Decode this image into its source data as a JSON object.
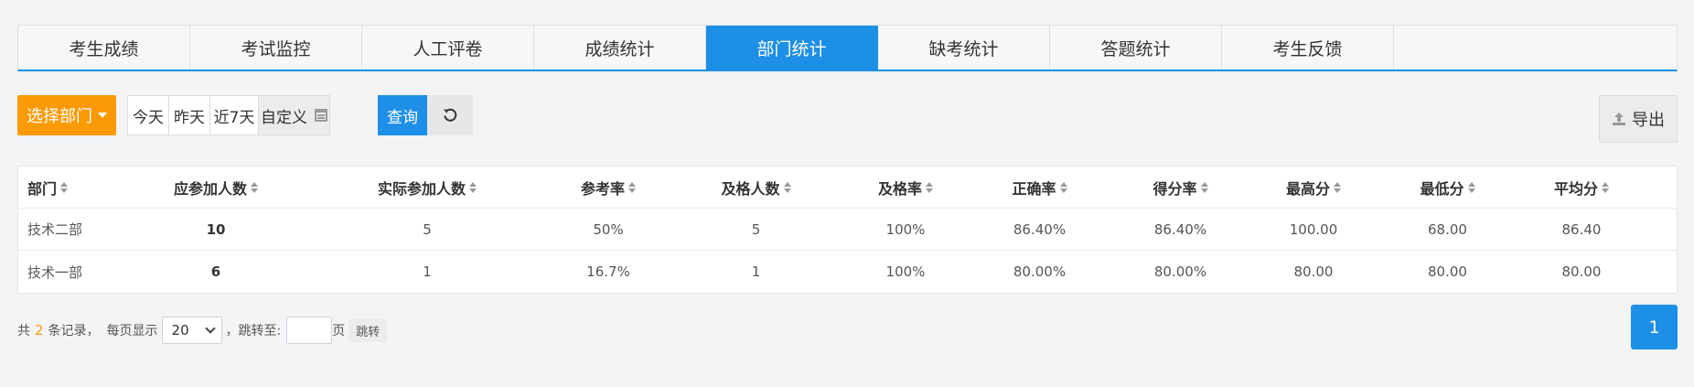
{
  "tabs": [
    {
      "label": "考生成绩",
      "active": false
    },
    {
      "label": "考试监控",
      "active": false
    },
    {
      "label": "人工评卷",
      "active": false
    },
    {
      "label": "成绩统计",
      "active": false
    },
    {
      "label": "部门统计",
      "active": true
    },
    {
      "label": "缺考统计",
      "active": false
    },
    {
      "label": "答题统计",
      "active": false
    },
    {
      "label": "考生反馈",
      "active": false
    }
  ],
  "toolbar": {
    "dept_label": "选择部门",
    "ranges": [
      "今天",
      "昨天",
      "近7天",
      "自定义"
    ],
    "query_label": "查询",
    "reset_icon": "refresh-icon",
    "export_label": "导出",
    "export_icon": "upload-icon"
  },
  "table": {
    "headers": [
      "部门",
      "应参加人数",
      "实际参加人数",
      "参考率",
      "及格人数",
      "及格率",
      "正确率",
      "得分率",
      "最高分",
      "最低分",
      "平均分"
    ],
    "rows": [
      [
        "技术二部",
        "10",
        "5",
        "50%",
        "5",
        "100%",
        "86.40%",
        "86.40%",
        "100.00",
        "68.00",
        "86.40"
      ],
      [
        "技术一部",
        "6",
        "1",
        "16.7%",
        "1",
        "100%",
        "80.00%",
        "80.00%",
        "80.00",
        "80.00",
        "80.00"
      ]
    ]
  },
  "pagination": {
    "prefix": "共",
    "total": "2",
    "suffix": "条记录，",
    "per_page_label": "每页显示",
    "per_page_value": "20",
    "jump_label": "，跳转至:",
    "page_unit": "页",
    "jump_button": "跳转",
    "current_page": "1"
  },
  "colors": {
    "primary": "#1e8fe6",
    "accent": "#fb9a05"
  }
}
